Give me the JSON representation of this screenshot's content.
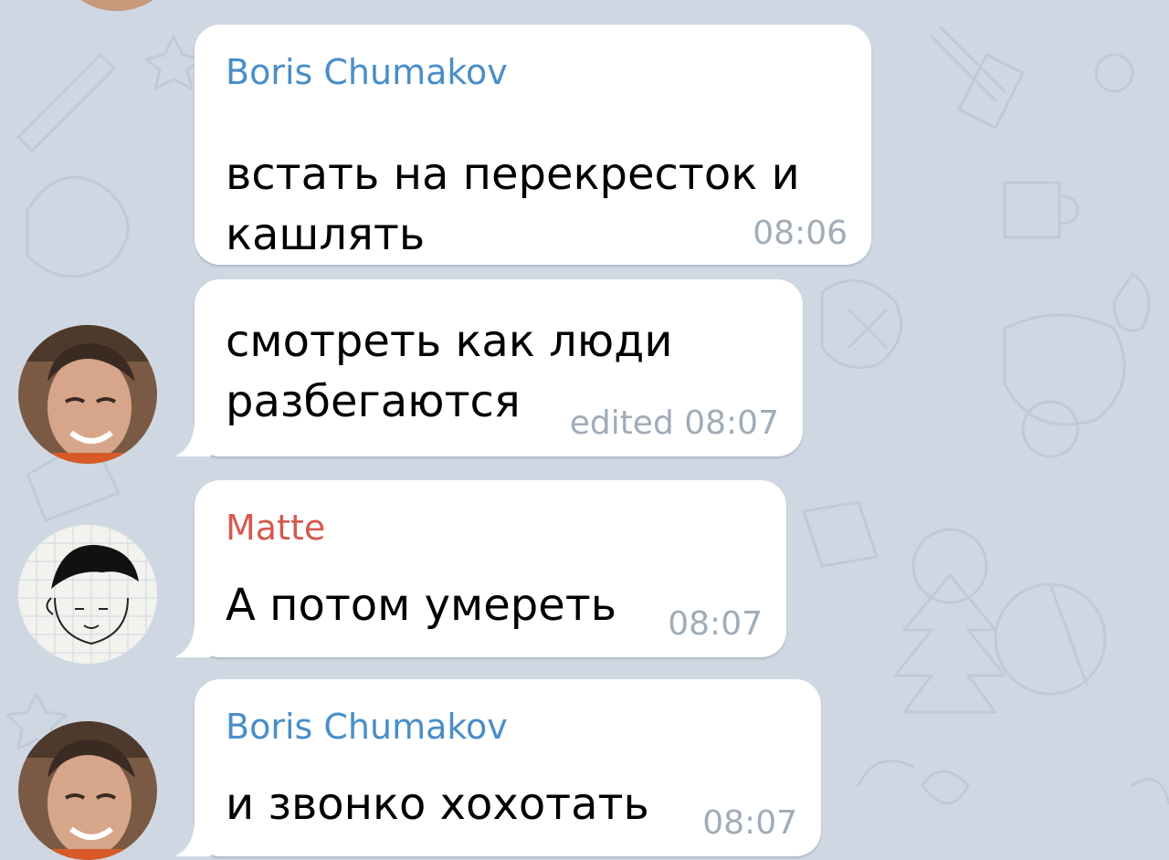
{
  "colors": {
    "background": "#cfd8e2",
    "bubble": "#ffffff",
    "boris_name": "#4a8ec8",
    "matte_name": "#d35a4f",
    "time": "#a0acb8"
  },
  "messages": [
    {
      "sender": "Boris Chumakov",
      "lines": [
        "встать на перекресток и",
        "кашлять"
      ],
      "time": "08:06"
    },
    {
      "lines": [
        "смотреть как люди",
        "разбегаются"
      ],
      "time": "edited 08:07"
    },
    {
      "sender": "Matte",
      "lines": [
        "А потом умереть"
      ],
      "time": "08:07"
    },
    {
      "sender": "Boris Chumakov",
      "lines": [
        "и звонко хохотать"
      ],
      "time": "08:07"
    }
  ],
  "avatars": [
    {
      "icon": "boris-avatar-photo"
    },
    {
      "icon": "matte-avatar-doodle"
    },
    {
      "icon": "boris-avatar-photo"
    }
  ]
}
